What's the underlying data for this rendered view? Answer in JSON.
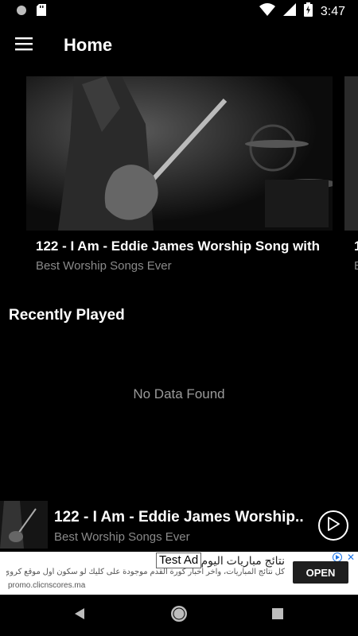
{
  "status_bar": {
    "time": "3:47",
    "icons": [
      "record-icon",
      "sd-card-icon",
      "wifi-icon",
      "signal-icon",
      "battery-charging-icon"
    ]
  },
  "app_bar": {
    "title": "Home",
    "menu_icon": "hamburger-menu-icon"
  },
  "carousel": {
    "items": [
      {
        "title": "122 - I Am - Eddie James Worship Song with",
        "subtitle": "Best Worship Songs Ever"
      },
      {
        "title": "1",
        "subtitle": "B"
      }
    ]
  },
  "recently_played": {
    "title": "Recently Played",
    "empty_text": "No Data Found"
  },
  "mini_player": {
    "title": "122 - I Am - Eddie James Worship..",
    "subtitle": "Best Worship Songs Ever",
    "play_icon": "play-icon"
  },
  "ad": {
    "badge": "Test Ad",
    "headline": "نتائج مباريات اليوم",
    "body": "كل نتائج المباريات، وآخر أخبار كورة القدم موجودة على كليك لو سكون أول موقع كروي في المغرب",
    "url": "promo.clicnscores.ma",
    "cta": "OPEN",
    "close": "✕"
  },
  "colors": {
    "background": "#000000",
    "text_primary": "#ffffff",
    "text_secondary": "#8a8a8a"
  }
}
